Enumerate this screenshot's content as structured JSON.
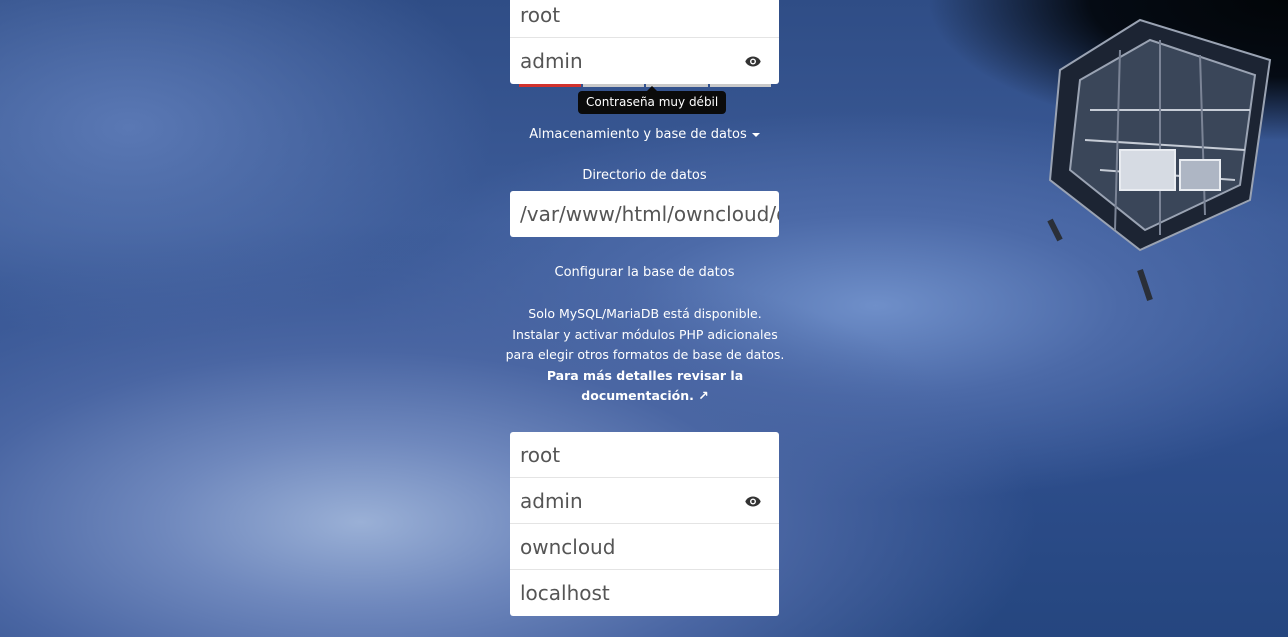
{
  "admin_account": {
    "username_value": "root",
    "password_value": "admin"
  },
  "password_strength": {
    "tooltip": "Contraseña muy débil",
    "level": 1,
    "max_level": 4
  },
  "storage_toggle": {
    "label": "Almacenamiento y base de datos"
  },
  "data_directory": {
    "label": "Directorio de datos",
    "value": "/var/www/html/owncloud/d"
  },
  "database": {
    "heading": "Configurar la base de datos",
    "info_line1": "Solo MySQL/MariaDB está disponible. Instalar y activar módulos PHP adicionales para elegir otros formatos de base de datos.",
    "info_link": "Para más detalles revisar la documentación. ↗",
    "user_value": "root",
    "password_value": "admin",
    "name_value": "owncloud",
    "host_value": "localhost"
  },
  "icons": {
    "show_password": "eye-icon",
    "dropdown": "caret-down-icon"
  },
  "colors": {
    "strength_weak": "#d2322d",
    "strength_empty": "#c9c9c9",
    "tooltip_bg": "#0b0b0b"
  }
}
